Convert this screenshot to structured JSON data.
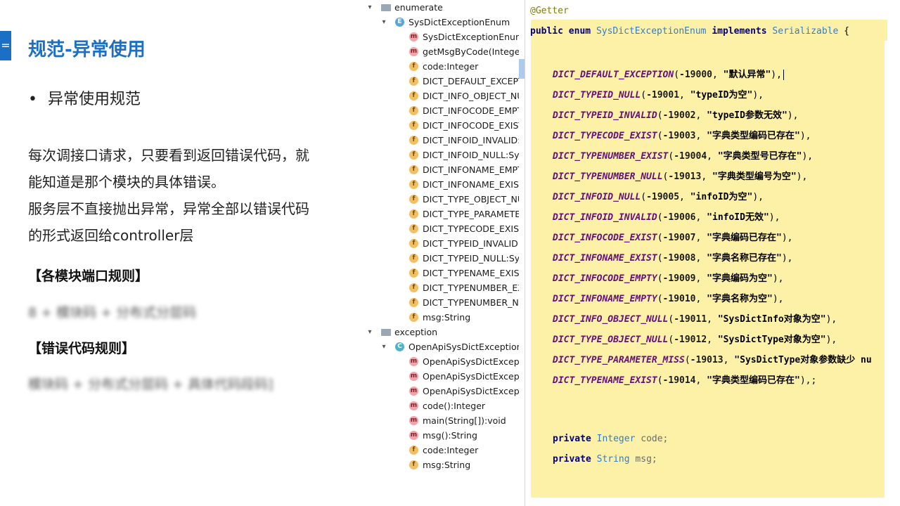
{
  "slide": {
    "marker": "=",
    "title": "规范-异常使用",
    "bullet": "异常使用规范",
    "paragraph": [
      "每次调接口请求，只要看到返回错误代码，就",
      "能知道是那个模块的具体错误。",
      "服务层不直接抛出异常，异常全部以错误代码",
      "的形式返回给controller层"
    ],
    "section1": "【各模块端口规则】",
    "section2": "【错误代码规则】",
    "blurred1": "8 + 模块码 + 分布式分层码",
    "blurred2": "模块码 + 分布式分层码 + 具体代码段码]"
  },
  "tree": {
    "rows": [
      {
        "label": "enumerate",
        "icon": "folder-icon",
        "arrow": "▾"
      },
      {
        "label": "SysDictExceptionEnum",
        "icon": "enum-icon",
        "arrow": "▾"
      },
      {
        "label": "SysDictExceptionEnum(I",
        "icon": "method-icon",
        "arrow": ""
      },
      {
        "label": "getMsgByCode(Integer",
        "icon": "method-icon",
        "arrow": ""
      },
      {
        "label": "code:Integer",
        "icon": "field-icon",
        "arrow": ""
      },
      {
        "label": "DICT_DEFAULT_EXCEPT",
        "icon": "field-icon",
        "arrow": ""
      },
      {
        "label": "DICT_INFO_OBJECT_NU",
        "icon": "field-icon",
        "arrow": ""
      },
      {
        "label": "DICT_INFOCODE_EMPT",
        "icon": "field-icon",
        "arrow": ""
      },
      {
        "label": "DICT_INFOCODE_EXIST",
        "icon": "field-icon",
        "arrow": ""
      },
      {
        "label": "DICT_INFOID_INVALID:S",
        "icon": "field-icon",
        "arrow": ""
      },
      {
        "label": "DICT_INFOID_NULL:Sys",
        "icon": "field-icon",
        "arrow": ""
      },
      {
        "label": "DICT_INFONAME_EMPT",
        "icon": "field-icon",
        "arrow": ""
      },
      {
        "label": "DICT_INFONAME_EXIST",
        "icon": "field-icon",
        "arrow": ""
      },
      {
        "label": "DICT_TYPE_OBJECT_NU",
        "icon": "field-icon",
        "arrow": ""
      },
      {
        "label": "DICT_TYPE_PARAMETER",
        "icon": "field-icon",
        "arrow": ""
      },
      {
        "label": "DICT_TYPECODE_EXIST:",
        "icon": "field-icon",
        "arrow": ""
      },
      {
        "label": "DICT_TYPEID_INVALID:S",
        "icon": "field-icon",
        "arrow": ""
      },
      {
        "label": "DICT_TYPEID_NULL:SysI",
        "icon": "field-icon",
        "arrow": ""
      },
      {
        "label": "DICT_TYPENAME_EXIST",
        "icon": "field-icon",
        "arrow": ""
      },
      {
        "label": "DICT_TYPENUMBER_EX",
        "icon": "field-icon",
        "arrow": ""
      },
      {
        "label": "DICT_TYPENUMBER_NU",
        "icon": "field-icon",
        "arrow": ""
      },
      {
        "label": "msg:String",
        "icon": "field-icon",
        "arrow": ""
      },
      {
        "label": "exception",
        "icon": "folder-icon",
        "arrow": "▾"
      },
      {
        "label": "OpenApiSysDictException",
        "icon": "class-icon",
        "arrow": "▾"
      },
      {
        "label": "OpenApiSysDictExcepti",
        "icon": "method-icon",
        "arrow": ""
      },
      {
        "label": "OpenApiSysDictExcepti",
        "icon": "method-icon",
        "arrow": ""
      },
      {
        "label": "OpenApiSysDictExcepti",
        "icon": "method-icon",
        "arrow": ""
      },
      {
        "label": "code():Integer",
        "icon": "method-icon",
        "arrow": ""
      },
      {
        "label": "main(String[]):void",
        "icon": "method-icon",
        "arrow": ""
      },
      {
        "label": "msg():String",
        "icon": "method-icon",
        "arrow": ""
      },
      {
        "label": "code:Integer",
        "icon": "field-icon",
        "arrow": ""
      },
      {
        "label": "msg:String",
        "icon": "field-icon",
        "arrow": ""
      }
    ]
  },
  "editor": {
    "annotation": "@Getter",
    "decl": {
      "k1": "public",
      "k2": "enum",
      "name": "SysDictExceptionEnum",
      "k3": "implements",
      "iface": "Serializable",
      "brace": "{"
    },
    "constants": [
      {
        "name": "DICT_DEFAULT_EXCEPTION",
        "code": "-19000",
        "msg": "\"默认异常\"",
        "end": "),"
      },
      {
        "name": "DICT_TYPEID_NULL",
        "code": "-19001",
        "msg": "\"typeID为空\"",
        "end": "),"
      },
      {
        "name": "DICT_TYPEID_INVALID",
        "code": "-19002",
        "msg": "\"typeID参数无效\"",
        "end": "),"
      },
      {
        "name": "DICT_TYPECODE_EXIST",
        "code": "-19003",
        "msg": "\"字典类型编码已存在\"",
        "end": "),"
      },
      {
        "name": "DICT_TYPENUMBER_EXIST",
        "code": "-19004",
        "msg": "\"字典类型号已存在\"",
        "end": "),"
      },
      {
        "name": "DICT_TYPENUMBER_NULL",
        "code": "-19013",
        "msg": "\"字典类型编号为空\"",
        "end": "),"
      },
      {
        "name": "DICT_INFOID_NULL",
        "code": "-19005",
        "msg": "\"infoID为空\"",
        "end": "),"
      },
      {
        "name": "DICT_INFOID_INVALID",
        "code": "-19006",
        "msg": "\"infoID无效\"",
        "end": "),"
      },
      {
        "name": "DICT_INFOCODE_EXIST",
        "code": "-19007",
        "msg": "\"字典编码已存在\"",
        "end": "),"
      },
      {
        "name": "DICT_INFONAME_EXIST",
        "code": "-19008",
        "msg": "\"字典名称已存在\"",
        "end": "),"
      },
      {
        "name": "DICT_INFOCODE_EMPTY",
        "code": "-19009",
        "msg": "\"字典编码为空\"",
        "end": "),"
      },
      {
        "name": "DICT_INFONAME_EMPTY",
        "code": "-19010",
        "msg": "\"字典名称为空\"",
        "end": "),"
      },
      {
        "name": "DICT_INFO_OBJECT_NULL",
        "code": "-19011",
        "msg": "\"SysDictInfo对象为空\"",
        "end": "),"
      },
      {
        "name": "DICT_TYPE_OBJECT_NULL",
        "code": "-19012",
        "msg": "\"SysDictType对象为空\"",
        "end": "),"
      },
      {
        "name": "DICT_TYPE_PARAMETER_MISS",
        "code": "-19013",
        "msg": "\"SysDictType对象参数缺少 nu",
        "end": ""
      },
      {
        "name": "DICT_TYPENAME_EXIST",
        "code": "-19014",
        "msg": "\"字典类型编码已存在\"",
        "end": "),;"
      }
    ],
    "fields": [
      {
        "mod": "private",
        "type": "Integer",
        "name": "code;"
      },
      {
        "mod": "private",
        "type": "String",
        "name": "msg;"
      }
    ]
  }
}
